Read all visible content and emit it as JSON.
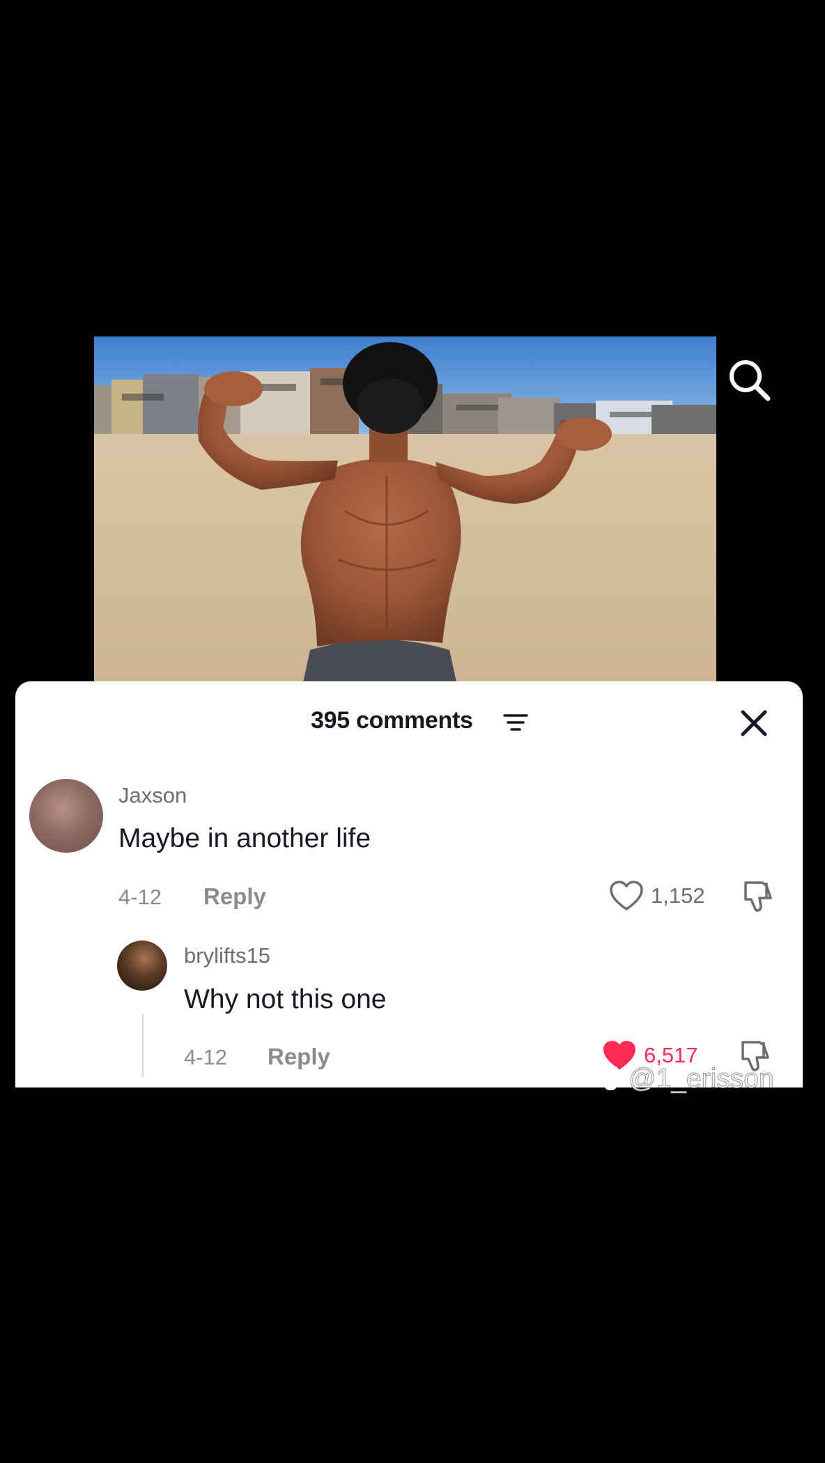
{
  "comments_sheet": {
    "count_label": "395 comments"
  },
  "comments": [
    {
      "username": "Jaxson",
      "text": "Maybe in another life",
      "date": "4-12",
      "reply_label": "Reply",
      "likes": "1,152",
      "liked": false
    },
    {
      "username": "brylifts15",
      "text": "Why not this one",
      "date": "4-12",
      "reply_label": "Reply",
      "likes": "6,517",
      "liked": true
    }
  ],
  "watermark": {
    "handle": "@1_erisson"
  },
  "icons": {
    "search": "search-icon",
    "filter": "filter-icon",
    "close": "close-icon",
    "heart": "heart-icon",
    "dislike": "thumbs-down-icon",
    "tiktok": "tiktok-logo-icon"
  },
  "colors": {
    "liked": "#fe2c55",
    "background": "#000000",
    "sheet": "#ffffff"
  }
}
